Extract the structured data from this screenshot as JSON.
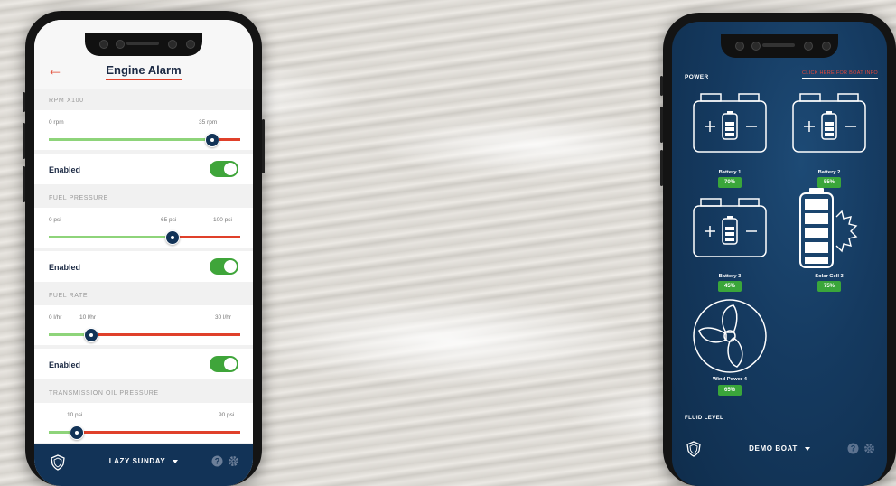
{
  "left_phone": {
    "title": "Engine Alarm",
    "back_icon": "arrow-left-icon",
    "sections": [
      {
        "heading": "RPM X100",
        "min": "0 rpm",
        "value": "35 rpm",
        "max": "",
        "level_pct": 83,
        "enabled_label": "Enabled",
        "enabled": true
      },
      {
        "heading": "FUEL PRESSURE",
        "min": "0 psi",
        "value": "65 psi",
        "max": "100 psi",
        "level_pct": 63,
        "enabled_label": "Enabled",
        "enabled": true
      },
      {
        "heading": "FUEL RATE",
        "min": "0 l/hr",
        "value": "10 l/hr",
        "max": "30 l/hr",
        "level_pct": 22,
        "enabled_label": "Enabled",
        "enabled": true
      },
      {
        "heading": "TRANSMISSION OIL PRESSURE",
        "min": "",
        "value": "10 psi",
        "max": "90 psi",
        "level_pct": 14
      }
    ],
    "footer": {
      "boat_name": "LAZY SUNDAY",
      "logo_icon": "shield-logo-icon",
      "help_icon": "help-icon",
      "settings_icon": "gear-icon"
    }
  },
  "right_phone": {
    "power_heading": "POWER",
    "power_link": "CLICK HERE FOR BOAT INFO",
    "tiles": [
      {
        "label": "Battery 1",
        "value": "70%",
        "icon": "battery-icon"
      },
      {
        "label": "Battery 2",
        "value": "55%",
        "icon": "battery-icon"
      },
      {
        "label": "Battery 3",
        "value": "45%",
        "icon": "battery-icon"
      },
      {
        "label": "Solar Cell 3",
        "value": "75%",
        "icon": "solar-cell-icon"
      },
      {
        "label": "Wind Power 4",
        "value": "65%",
        "icon": "wind-turbine-icon"
      }
    ],
    "fluid_heading": "FLUID LEVEL",
    "footer": {
      "boat_name": "DEMO BOAT",
      "logo_icon": "shield-logo-icon",
      "help_icon": "help-icon",
      "settings_icon": "gear-icon"
    }
  },
  "colors": {
    "navy": "#123357",
    "accent_red": "#e0402a",
    "slider_green": "#8ed47a",
    "toggle_green": "#3fa53a",
    "badge_green": "#3aa63a"
  }
}
